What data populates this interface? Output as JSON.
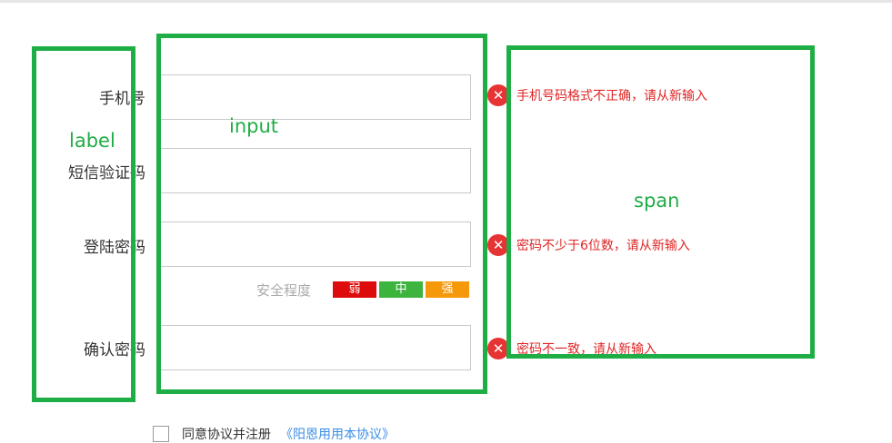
{
  "annotations": {
    "label": "label",
    "input": "input",
    "span": "span"
  },
  "form": {
    "phone_label": "手机号",
    "sms_label": "短信验证码",
    "password_label": "登陆密码",
    "confirm_label": "确认密码",
    "colon": ":",
    "phone_value": "",
    "sms_value": "",
    "password_value": "",
    "confirm_value": ""
  },
  "strength": {
    "title": "安全程度",
    "weak": "弱",
    "medium": "中",
    "strong": "强",
    "colors": {
      "weak": "#dd0b0b",
      "medium": "#3db43d",
      "strong": "#f5980a"
    }
  },
  "errors": {
    "icon": "close-circle-icon",
    "phone": "手机号码格式不正确，请从新输入",
    "password": "密码不少于6位数，请从新输入",
    "confirm": "密码不一致，请从新输入"
  },
  "agreement": {
    "text": "同意协议并注册",
    "link": "《阳恩用用本协议》"
  },
  "colors": {
    "annotation": "#1fad45",
    "error": "#e02525"
  }
}
